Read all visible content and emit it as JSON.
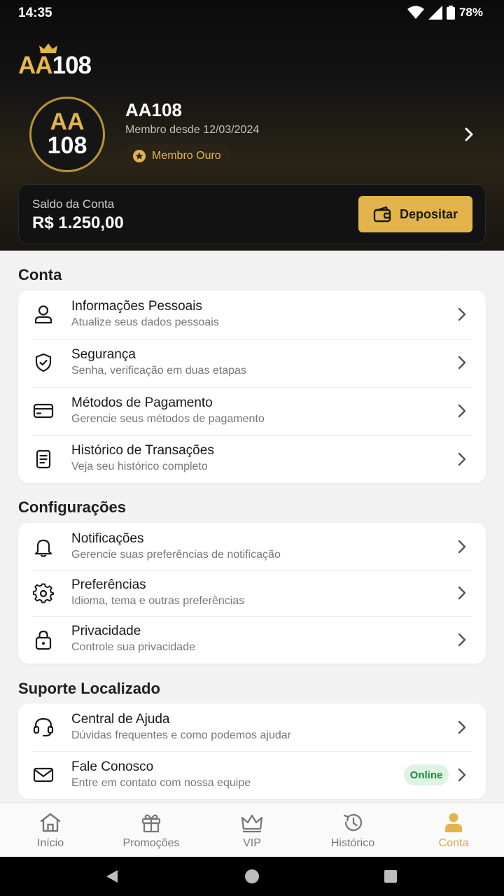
{
  "status": {
    "time": "14:35",
    "battery": "78%"
  },
  "logo": {
    "aa": "AA",
    "num": "108"
  },
  "profile": {
    "avatar_line1": "AA",
    "avatar_line2": "108",
    "name": "AA108",
    "member_since": "Membro desde 12/03/2024",
    "badge": "Membro Ouro"
  },
  "balance": {
    "label": "Saldo da Conta",
    "value": "R$ 1.250,00",
    "deposit_label": "Depositar"
  },
  "sections": [
    {
      "title": "Conta",
      "items": [
        {
          "title": "Informações Pessoais",
          "subtitle": "Atualize seus dados pessoais",
          "icon": "user-icon"
        },
        {
          "title": "Segurança",
          "subtitle": "Senha, verificação em duas etapas",
          "icon": "shield-icon"
        },
        {
          "title": "Métodos de Pagamento",
          "subtitle": "Gerencie seus métodos de pagamento",
          "icon": "credit-card-icon"
        },
        {
          "title": "Histórico de Transações",
          "subtitle": "Veja seu histórico completo",
          "icon": "document-icon"
        }
      ]
    },
    {
      "title": "Configurações",
      "items": [
        {
          "title": "Notificações",
          "subtitle": "Gerencie suas preferências de notificação",
          "icon": "bell-icon"
        },
        {
          "title": "Preferências",
          "subtitle": "Idioma, tema e outras preferências",
          "icon": "gear-icon"
        },
        {
          "title": "Privacidade",
          "subtitle": "Controle sua privacidade",
          "icon": "lock-icon"
        }
      ]
    },
    {
      "title": "Suporte Localizado",
      "items": [
        {
          "title": "Central de Ajuda",
          "subtitle": "Dúvidas frequentes e como podemos ajudar",
          "icon": "headset-icon"
        },
        {
          "title": "Fale Conosco",
          "subtitle": "Entre em contato com nossa equipe",
          "icon": "mail-icon",
          "badge": "Online"
        }
      ]
    }
  ],
  "nav": {
    "items": [
      {
        "label": "Início",
        "icon": "home-icon"
      },
      {
        "label": "Promoções",
        "icon": "gift-icon"
      },
      {
        "label": "VIP",
        "icon": "crown-icon"
      },
      {
        "label": "Histórico",
        "icon": "history-icon"
      },
      {
        "label": "Conta",
        "icon": "account-icon",
        "active": true
      }
    ]
  },
  "colors": {
    "accent": "#e3b44c",
    "online_bg": "#dff3e2",
    "online_text": "#1f8a3a"
  }
}
